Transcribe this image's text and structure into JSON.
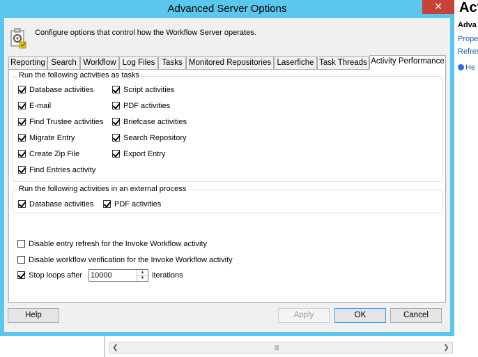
{
  "dialog": {
    "title": "Advanced Server Options",
    "close_label": "✕",
    "header_text": "Configure options that control how the Workflow Server operates."
  },
  "tabs": [
    {
      "label": "Reporting",
      "active": false
    },
    {
      "label": "Search",
      "active": false
    },
    {
      "label": "Workflow",
      "active": false
    },
    {
      "label": "Log Files",
      "active": false
    },
    {
      "label": "Tasks",
      "active": false
    },
    {
      "label": "Monitored Repositories",
      "active": false
    },
    {
      "label": "Laserfiche",
      "active": false
    },
    {
      "label": "Task Threads",
      "active": false
    },
    {
      "label": "Activity Performance",
      "active": true
    }
  ],
  "tasks_group": {
    "title": "Run the following activities as tasks",
    "col1": [
      {
        "label": "Database activities",
        "checked": true
      },
      {
        "label": "E-mail",
        "checked": true
      },
      {
        "label": "Find Trustee activities",
        "checked": true
      },
      {
        "label": "Migrate Entry",
        "checked": true
      },
      {
        "label": "Create Zip File",
        "checked": true
      },
      {
        "label": "Find Entries activity",
        "checked": true
      }
    ],
    "col2": [
      {
        "label": "Script activities",
        "checked": true
      },
      {
        "label": "PDF activities",
        "checked": true
      },
      {
        "label": "Briefcase activities",
        "checked": true
      },
      {
        "label": "Search Repository",
        "checked": true
      },
      {
        "label": "Export Entry",
        "checked": true
      }
    ]
  },
  "external_group": {
    "title": "Run the following activities in an external process",
    "items": [
      {
        "label": "Database activities",
        "checked": true
      },
      {
        "label": "PDF activities",
        "checked": true
      }
    ]
  },
  "options": {
    "disable_refresh": {
      "label": "Disable entry refresh for the Invoke Workflow activity",
      "checked": false
    },
    "disable_verification": {
      "label": "Disable workflow verification for the Invoke Workflow activity",
      "checked": false
    },
    "stop_loops": {
      "label": "Stop loops after",
      "checked": true,
      "value": "10000",
      "suffix": "iterations"
    }
  },
  "buttons": {
    "help": "Help",
    "apply": "Apply",
    "ok": "OK",
    "cancel": "Cancel"
  },
  "background": {
    "title_fragment": "Act",
    "subtitle_fragment": "Adva",
    "link1": "Prope",
    "link2": "Refres",
    "help_link": "He"
  },
  "colors": {
    "title_bar": "#5ac8ee",
    "close": "#c7423a",
    "default_button_border": "#3399ff"
  }
}
